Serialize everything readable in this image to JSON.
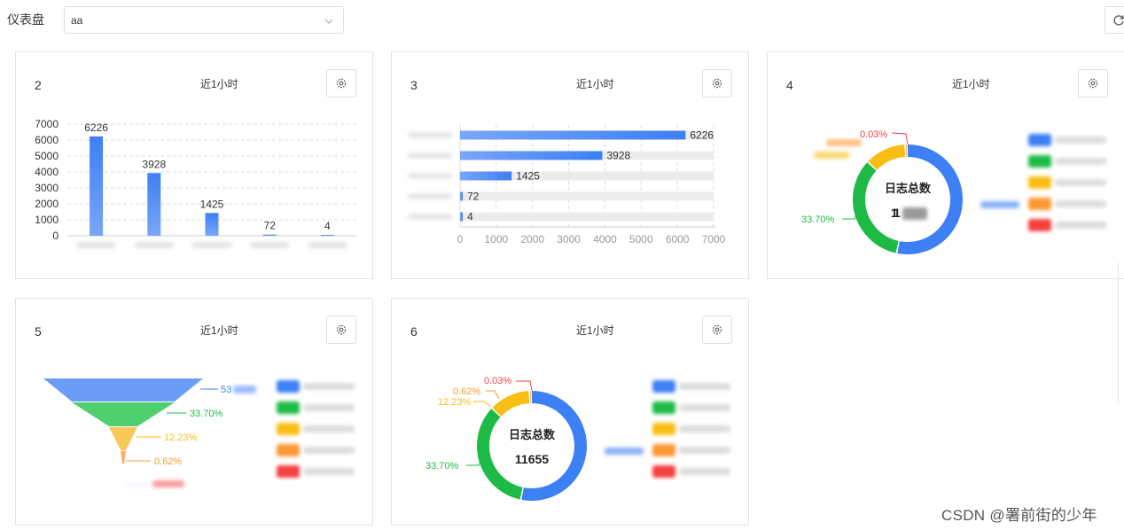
{
  "header": {
    "title": "仪表盘",
    "select_value": "aa"
  },
  "colors": {
    "blue": "#3d7ff5",
    "green": "#1dbb45",
    "yellow": "#f9be16",
    "orange": "#fb9834",
    "red": "#f4413f",
    "grey_track": "#ececec"
  },
  "cards": [
    {
      "id": "2",
      "title": "2",
      "time_range": "近1小时",
      "chart_data": {
        "type": "bar",
        "categories": [
          "",
          "",
          "",
          "",
          ""
        ],
        "values": [
          6226,
          3928,
          1425,
          72,
          4
        ],
        "data_labels": [
          "6226",
          "3928",
          "1425",
          "72",
          "4"
        ],
        "yticks": [
          "7000",
          "6000",
          "5000",
          "4000",
          "3000",
          "2000",
          "1000",
          "0"
        ],
        "ylim": [
          0,
          7000
        ],
        "grid": true
      }
    },
    {
      "id": "3",
      "title": "3",
      "time_range": "近1小时",
      "chart_data": {
        "type": "bar",
        "orientation": "horizontal",
        "categories": [
          "",
          "",
          "",
          "",
          ""
        ],
        "values": [
          6226,
          3928,
          1425,
          72,
          4
        ],
        "data_labels": [
          "6226",
          "3928",
          "1425",
          "72",
          "4"
        ],
        "xticks": [
          "0",
          "1000",
          "2000",
          "3000",
          "4000",
          "5000",
          "6000",
          "7000"
        ],
        "xlim": [
          0,
          7000
        ],
        "grid": true
      }
    },
    {
      "id": "4",
      "title": "4",
      "time_range": "近1小时",
      "center_title": "日志总数",
      "center_value": "11655",
      "slice_labels": [
        "0.03%",
        "33.70%"
      ],
      "chart_data": {
        "type": "pie",
        "variant": "donut",
        "values_percent": [
          53.43,
          33.7,
          12.23,
          0.62,
          0.03
        ],
        "labels": [
          "",
          "33.70%",
          "",
          "",
          "0.03%"
        ]
      }
    },
    {
      "id": "5",
      "title": "5",
      "time_range": "近1小时",
      "funnel_labels": [
        "53",
        "33.70%",
        "12.23%",
        "0.62%"
      ],
      "chart_data": {
        "type": "funnel",
        "values_percent": [
          53.43,
          33.7,
          12.23,
          0.62,
          0.03
        ],
        "labels": [
          "53",
          "33.70%",
          "12.23%",
          "0.62%",
          ""
        ]
      }
    },
    {
      "id": "6",
      "title": "6",
      "time_range": "近1小时",
      "center_title": "日志总数",
      "center_value": "11655",
      "slice_labels": [
        "0.03%",
        "0.62%",
        "12.23%",
        "33.70%"
      ],
      "chart_data": {
        "type": "pie",
        "variant": "donut",
        "values_percent": [
          53.43,
          33.7,
          12.23,
          0.62,
          0.03
        ],
        "labels": [
          "",
          "33.70%",
          "12.23%",
          "0.62%",
          "0.03%"
        ]
      }
    }
  ],
  "watermark": "CSDN @署前街的少年"
}
